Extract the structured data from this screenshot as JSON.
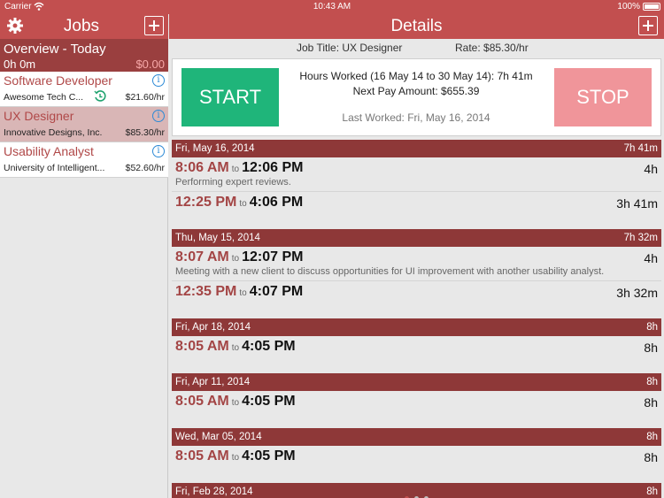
{
  "status": {
    "carrier": "Carrier",
    "time": "10:43 AM",
    "battery": "100%"
  },
  "left": {
    "title": "Jobs",
    "overview": {
      "title": "Overview - Today",
      "hours": "0h 0m",
      "amount": "$0.00"
    },
    "jobs": [
      {
        "name": "Software Developer",
        "company": "Awesome Tech C...",
        "rate": "$21.60/hr"
      },
      {
        "name": "UX Designer",
        "company": "Innovative Designs, Inc.",
        "rate": "$85.30/hr"
      },
      {
        "name": "Usability Analyst",
        "company": "University of Intelligent...",
        "rate": "$52.60/hr"
      }
    ]
  },
  "right": {
    "title": "Details",
    "job_title": "Job Title: UX Designer",
    "rate": "Rate: $85.30/hr",
    "start_label": "START",
    "stop_label": "STOP",
    "hours_worked": "Hours Worked (16 May 14  to  30 May 14): 7h 41m",
    "next_pay": "Next Pay Amount: $655.39",
    "last_worked": "Last Worked: Fri, May 16, 2014",
    "to_label": "to",
    "days": [
      {
        "date": "Fri, May 16, 2014",
        "total": "7h 41m",
        "entries": [
          {
            "start": "8:06 AM",
            "end": "12:06 PM",
            "duration": "4h",
            "note": "Performing expert reviews."
          },
          {
            "start": "12:25 PM",
            "end": "4:06 PM",
            "duration": "3h 41m",
            "note": ""
          }
        ]
      },
      {
        "date": "Thu, May 15, 2014",
        "total": "7h 32m",
        "entries": [
          {
            "start": "8:07 AM",
            "end": "12:07 PM",
            "duration": "4h",
            "note": "Meeting with a new client to discuss opportunities for UI improvement with another usability analyst."
          },
          {
            "start": "12:35 PM",
            "end": "4:07 PM",
            "duration": "3h 32m",
            "note": ""
          }
        ]
      },
      {
        "date": "Fri, Apr 18, 2014",
        "total": "8h",
        "entries": [
          {
            "start": "8:05 AM",
            "end": "4:05 PM",
            "duration": "8h",
            "note": ""
          }
        ]
      },
      {
        "date": "Fri, Apr 11, 2014",
        "total": "8h",
        "entries": [
          {
            "start": "8:05 AM",
            "end": "4:05 PM",
            "duration": "8h",
            "note": ""
          }
        ]
      },
      {
        "date": "Wed, Mar 05, 2014",
        "total": "8h",
        "entries": [
          {
            "start": "8:05 AM",
            "end": "4:05 PM",
            "duration": "8h",
            "note": ""
          }
        ]
      },
      {
        "date": "Fri, Feb 28, 2014",
        "total": "8h",
        "entries": []
      }
    ]
  },
  "colors": {
    "header": "#c24f4f",
    "day_header": "#8e3838",
    "start": "#1fb57a",
    "stop": "#f0959a",
    "selected_row": "#d9b6b6"
  }
}
